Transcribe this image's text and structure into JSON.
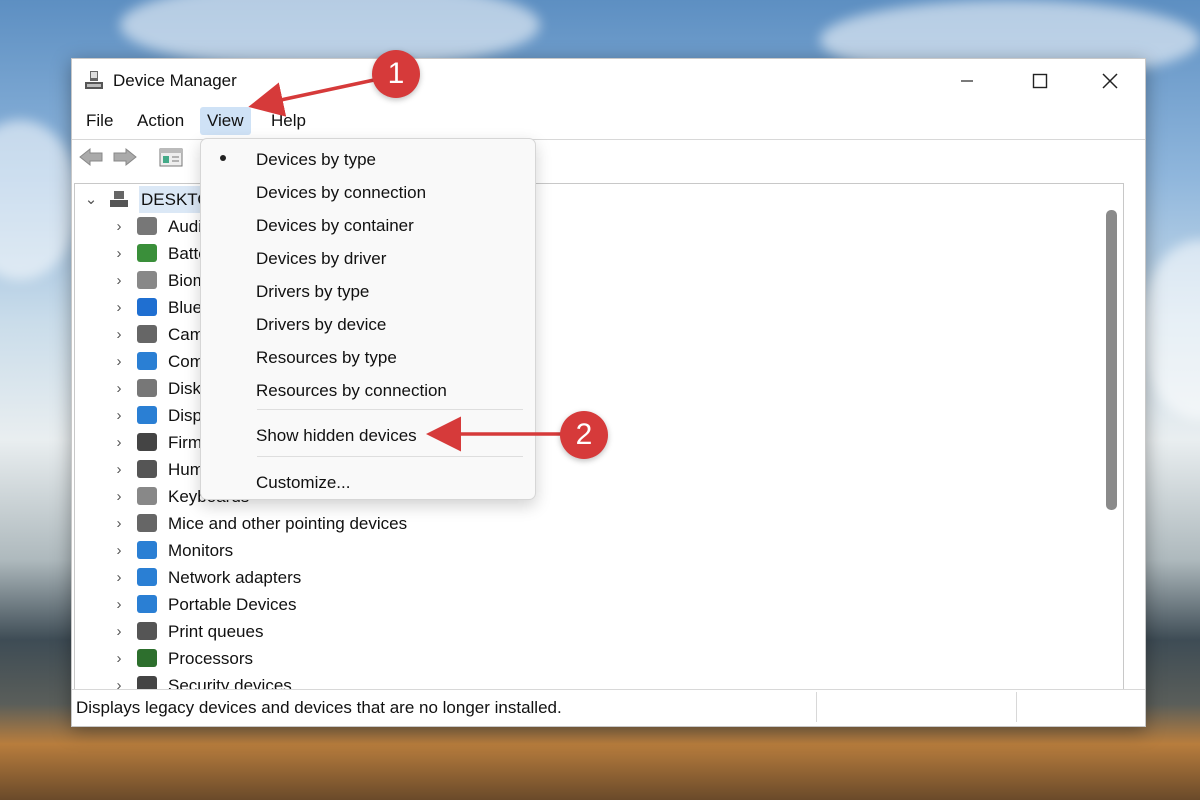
{
  "window": {
    "title": "Device Manager"
  },
  "menubar": {
    "items": [
      "File",
      "Action",
      "View",
      "Help"
    ]
  },
  "tree": {
    "root_label": "DESKTOP",
    "items": [
      {
        "label": "Audio inputs and outputs",
        "icon": "speaker-icon"
      },
      {
        "label": "Batteries",
        "icon": "battery-icon"
      },
      {
        "label": "Biometric devices",
        "icon": "fingerprint-icon"
      },
      {
        "label": "Bluetooth",
        "icon": "bluetooth-icon"
      },
      {
        "label": "Cameras",
        "icon": "camera-icon"
      },
      {
        "label": "Computer",
        "icon": "computer-icon"
      },
      {
        "label": "Disk drives",
        "icon": "disk-drive-icon"
      },
      {
        "label": "Display adapters",
        "icon": "display-adapter-icon"
      },
      {
        "label": "Firmware",
        "icon": "firmware-icon"
      },
      {
        "label": "Human Interface Devices",
        "icon": "hid-icon"
      },
      {
        "label": "Keyboards",
        "icon": "keyboard-icon"
      },
      {
        "label": "Mice and other pointing devices",
        "icon": "mouse-icon"
      },
      {
        "label": "Monitors",
        "icon": "monitor-icon"
      },
      {
        "label": "Network adapters",
        "icon": "network-adapter-icon"
      },
      {
        "label": "Portable Devices",
        "icon": "portable-device-icon"
      },
      {
        "label": "Print queues",
        "icon": "printer-icon"
      },
      {
        "label": "Processors",
        "icon": "processor-icon"
      },
      {
        "label": "Security devices",
        "icon": "security-device-icon"
      }
    ]
  },
  "view_menu": {
    "items": [
      {
        "label": "Devices by type",
        "checked": true
      },
      {
        "label": "Devices by connection",
        "checked": false
      },
      {
        "label": "Devices by container",
        "checked": false
      },
      {
        "label": "Devices by driver",
        "checked": false
      },
      {
        "label": "Drivers by type",
        "checked": false
      },
      {
        "label": "Drivers by device",
        "checked": false
      },
      {
        "label": "Resources by type",
        "checked": false
      },
      {
        "label": "Resources by connection",
        "checked": false
      }
    ],
    "show_hidden": "Show hidden devices",
    "customize": "Customize..."
  },
  "status_bar": {
    "text": "Displays legacy devices and devices that are no longer installed."
  },
  "annotations": {
    "badge_1": "1",
    "badge_2": "2",
    "color": "#d63a3a"
  }
}
